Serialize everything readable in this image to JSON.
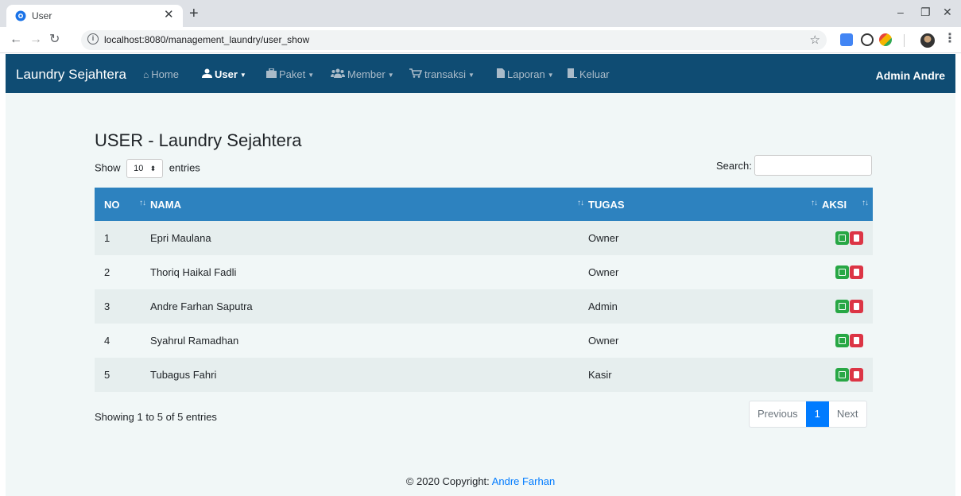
{
  "browser": {
    "tab_title": "User",
    "tab_close": "✕",
    "new_tab": "+",
    "url": "localhost:8080/management_laundry/user_show",
    "window_controls": {
      "minimize": "–",
      "restore": "❐",
      "close": "✕"
    }
  },
  "navbar": {
    "brand": "Laundry Sejahtera",
    "items": [
      {
        "label": "Home",
        "icon": "home-icon",
        "dropdown": false,
        "active": false
      },
      {
        "label": "User",
        "icon": "user-icon",
        "dropdown": true,
        "active": true
      },
      {
        "label": "Paket",
        "icon": "briefcase-icon",
        "dropdown": true,
        "active": false
      },
      {
        "label": "Member",
        "icon": "users-icon",
        "dropdown": true,
        "active": false
      },
      {
        "label": "transaksi",
        "icon": "cart-icon",
        "dropdown": true,
        "active": false
      },
      {
        "label": "Laporan",
        "icon": "file-icon",
        "dropdown": true,
        "active": false
      },
      {
        "label": "Keluar",
        "icon": "door-icon",
        "dropdown": false,
        "active": false
      }
    ],
    "user_label": "Admin Andre"
  },
  "page": {
    "title": "USER - Laundry Sejahtera",
    "length": {
      "show": "Show",
      "value": "10",
      "entries": "entries"
    },
    "search_label": "Search:",
    "search_value": ""
  },
  "table": {
    "columns": [
      "NO",
      "NAMA",
      "TUGAS",
      "AKSI"
    ],
    "rows": [
      {
        "no": "1",
        "nama": "Epri Maulana",
        "tugas": "Owner"
      },
      {
        "no": "2",
        "nama": "Thoriq Haikal Fadli",
        "tugas": "Owner"
      },
      {
        "no": "3",
        "nama": "Andre Farhan Saputra",
        "tugas": "Admin"
      },
      {
        "no": "4",
        "nama": "Syahrul Ramadhan",
        "tugas": "Owner"
      },
      {
        "no": "5",
        "nama": "Tubagus Fahri",
        "tugas": "Kasir"
      }
    ]
  },
  "info": "Showing 1 to 5 of 5 entries",
  "pagination": {
    "previous": "Previous",
    "current": "1",
    "next": "Next"
  },
  "footer": {
    "prefix": "© 2020 Copyright: ",
    "author": "Andre Farhan"
  },
  "colors": {
    "navbar": "#0f4c73",
    "table_header": "#2d82bf",
    "edit": "#28a745",
    "delete": "#dc3545",
    "link": "#007bff"
  }
}
